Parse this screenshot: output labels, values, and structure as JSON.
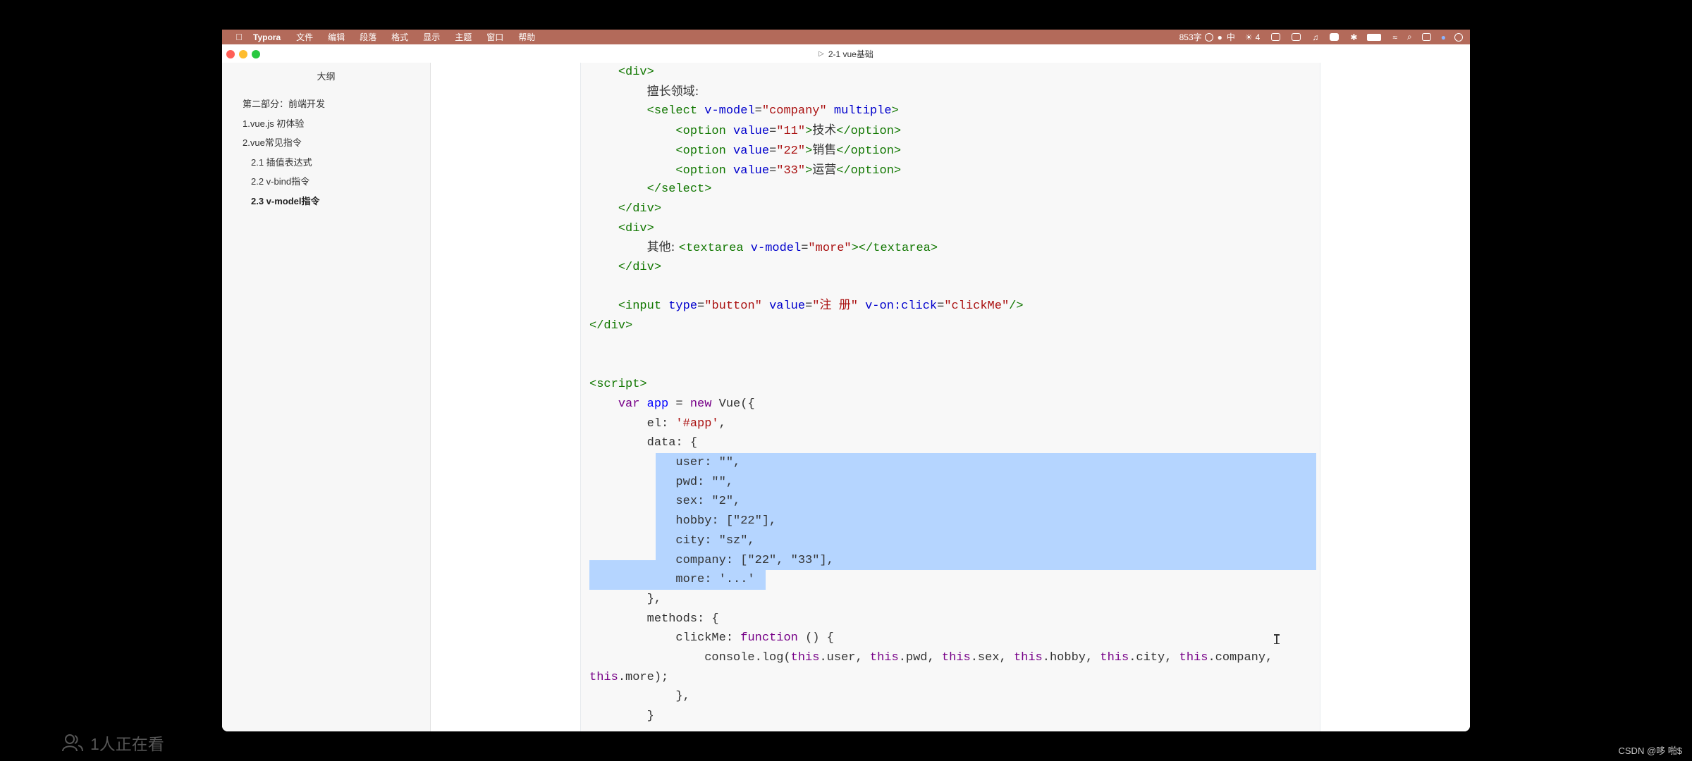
{
  "menubar": {
    "app_name": "Typora",
    "menus": [
      "文件",
      "编辑",
      "段落",
      "格式",
      "显示",
      "主题",
      "窗口",
      "帮助"
    ],
    "word_count": "853字",
    "input_method": "中",
    "wechat_count": "4"
  },
  "window": {
    "title": "2-1 vue基础"
  },
  "sidebar": {
    "title": "大纲",
    "items": [
      {
        "label": "第二部分：前端开发",
        "level": 1,
        "active": false
      },
      {
        "label": "1.vue.js 初体验",
        "level": 1,
        "active": false
      },
      {
        "label": "2.vue常见指令",
        "level": 1,
        "active": false
      },
      {
        "label": "2.1 插值表达式",
        "level": 2,
        "active": false
      },
      {
        "label": "2.2 v-bind指令",
        "level": 2,
        "active": false
      },
      {
        "label": "2.3 v-model指令",
        "level": 2,
        "active": true
      }
    ]
  },
  "code": {
    "lines": [
      [
        [
          "    ",
          ""
        ],
        [
          "<div>",
          "tag"
        ]
      ],
      [
        [
          "        ",
          ""
        ],
        [
          "擅长领域:",
          "zh"
        ]
      ],
      [
        [
          "        ",
          ""
        ],
        [
          "<select ",
          "tag"
        ],
        [
          "v-model",
          "attr"
        ],
        [
          "=",
          ""
        ],
        [
          "\"company\"",
          "str"
        ],
        [
          " ",
          ""
        ],
        [
          "multiple",
          "attr"
        ],
        [
          ">",
          "tag"
        ]
      ],
      [
        [
          "            ",
          ""
        ],
        [
          "<option ",
          "tag"
        ],
        [
          "value",
          "attr"
        ],
        [
          "=",
          ""
        ],
        [
          "\"11\"",
          "str"
        ],
        [
          ">",
          "tag"
        ],
        [
          "技术",
          "zh"
        ],
        [
          "</option>",
          "tag"
        ]
      ],
      [
        [
          "            ",
          ""
        ],
        [
          "<option ",
          "tag"
        ],
        [
          "value",
          "attr"
        ],
        [
          "=",
          ""
        ],
        [
          "\"22\"",
          "str"
        ],
        [
          ">",
          "tag"
        ],
        [
          "销售",
          "zh"
        ],
        [
          "</option>",
          "tag"
        ]
      ],
      [
        [
          "            ",
          ""
        ],
        [
          "<option ",
          "tag"
        ],
        [
          "value",
          "attr"
        ],
        [
          "=",
          ""
        ],
        [
          "\"33\"",
          "str"
        ],
        [
          ">",
          "tag"
        ],
        [
          "运营",
          "zh"
        ],
        [
          "</option>",
          "tag"
        ]
      ],
      [
        [
          "        ",
          ""
        ],
        [
          "</select>",
          "tag"
        ]
      ],
      [
        [
          "    ",
          ""
        ],
        [
          "</div>",
          "tag"
        ]
      ],
      [
        [
          "    ",
          ""
        ],
        [
          "<div>",
          "tag"
        ]
      ],
      [
        [
          "        ",
          ""
        ],
        [
          "其他: ",
          "zh"
        ],
        [
          "<textarea ",
          "tag"
        ],
        [
          "v-model",
          "attr"
        ],
        [
          "=",
          ""
        ],
        [
          "\"more\"",
          "str"
        ],
        [
          "></textarea>",
          "tag"
        ]
      ],
      [
        [
          "    ",
          ""
        ],
        [
          "</div>",
          "tag"
        ]
      ],
      [
        [
          "",
          ""
        ]
      ],
      [
        [
          "    ",
          ""
        ],
        [
          "<input ",
          "tag"
        ],
        [
          "type",
          "attr"
        ],
        [
          "=",
          ""
        ],
        [
          "\"button\"",
          "str"
        ],
        [
          " ",
          ""
        ],
        [
          "value",
          "attr"
        ],
        [
          "=",
          ""
        ],
        [
          "\"注 册\"",
          "str"
        ],
        [
          " ",
          ""
        ],
        [
          "v-on:click",
          "attr"
        ],
        [
          "=",
          ""
        ],
        [
          "\"clickMe\"",
          "str"
        ],
        [
          "/>",
          "tag"
        ]
      ],
      [
        [
          "",
          ""
        ],
        [
          "</div>",
          "tag"
        ]
      ],
      [
        [
          "",
          ""
        ]
      ],
      [
        [
          "",
          ""
        ]
      ],
      [
        [
          "",
          ""
        ],
        [
          "<script>",
          "tag"
        ]
      ],
      [
        [
          "    ",
          ""
        ],
        [
          "var ",
          "kw"
        ],
        [
          "app",
          "def"
        ],
        [
          " = ",
          ""
        ],
        [
          "new ",
          "kw"
        ],
        [
          "Vue({",
          ""
        ]
      ],
      [
        [
          "        el: ",
          ""
        ],
        [
          "'#app'",
          "str"
        ],
        [
          ",",
          ""
        ]
      ],
      [
        [
          "        data: {",
          ""
        ]
      ],
      [
        [
          "            user: \"\",",
          ""
        ]
      ],
      [
        [
          "            pwd: \"\",",
          ""
        ]
      ],
      [
        [
          "            sex: \"2\",",
          ""
        ]
      ],
      [
        [
          "            hobby: [\"22\"],",
          ""
        ]
      ],
      [
        [
          "            city: \"sz\",",
          ""
        ]
      ],
      [
        [
          "            company: [\"22\", \"33\"],",
          ""
        ]
      ],
      [
        [
          "            more: '...'",
          ""
        ]
      ],
      [
        [
          "        },",
          ""
        ]
      ],
      [
        [
          "        methods: {",
          ""
        ]
      ],
      [
        [
          "            clickMe: ",
          ""
        ],
        [
          "function",
          "kw"
        ],
        [
          " () {",
          ""
        ]
      ],
      [
        [
          "                console.log(",
          ""
        ],
        [
          "this",
          "kw"
        ],
        [
          ".user, ",
          ""
        ],
        [
          "this",
          "kw"
        ],
        [
          ".pwd, ",
          ""
        ],
        [
          "this",
          "kw"
        ],
        [
          ".sex, ",
          ""
        ],
        [
          "this",
          "kw"
        ],
        [
          ".hobby, ",
          ""
        ],
        [
          "this",
          "kw"
        ],
        [
          ".city, ",
          ""
        ],
        [
          "this",
          "kw"
        ],
        [
          ".company,",
          ""
        ]
      ],
      [
        [
          "",
          ""
        ],
        [
          "this",
          "kw"
        ],
        [
          ".more);",
          ""
        ]
      ],
      [
        [
          "            },",
          ""
        ]
      ],
      [
        [
          "        }",
          ""
        ]
      ]
    ]
  },
  "overlay": {
    "viewers": "1人正在看",
    "watermark": "CSDN @哆 啪$"
  }
}
